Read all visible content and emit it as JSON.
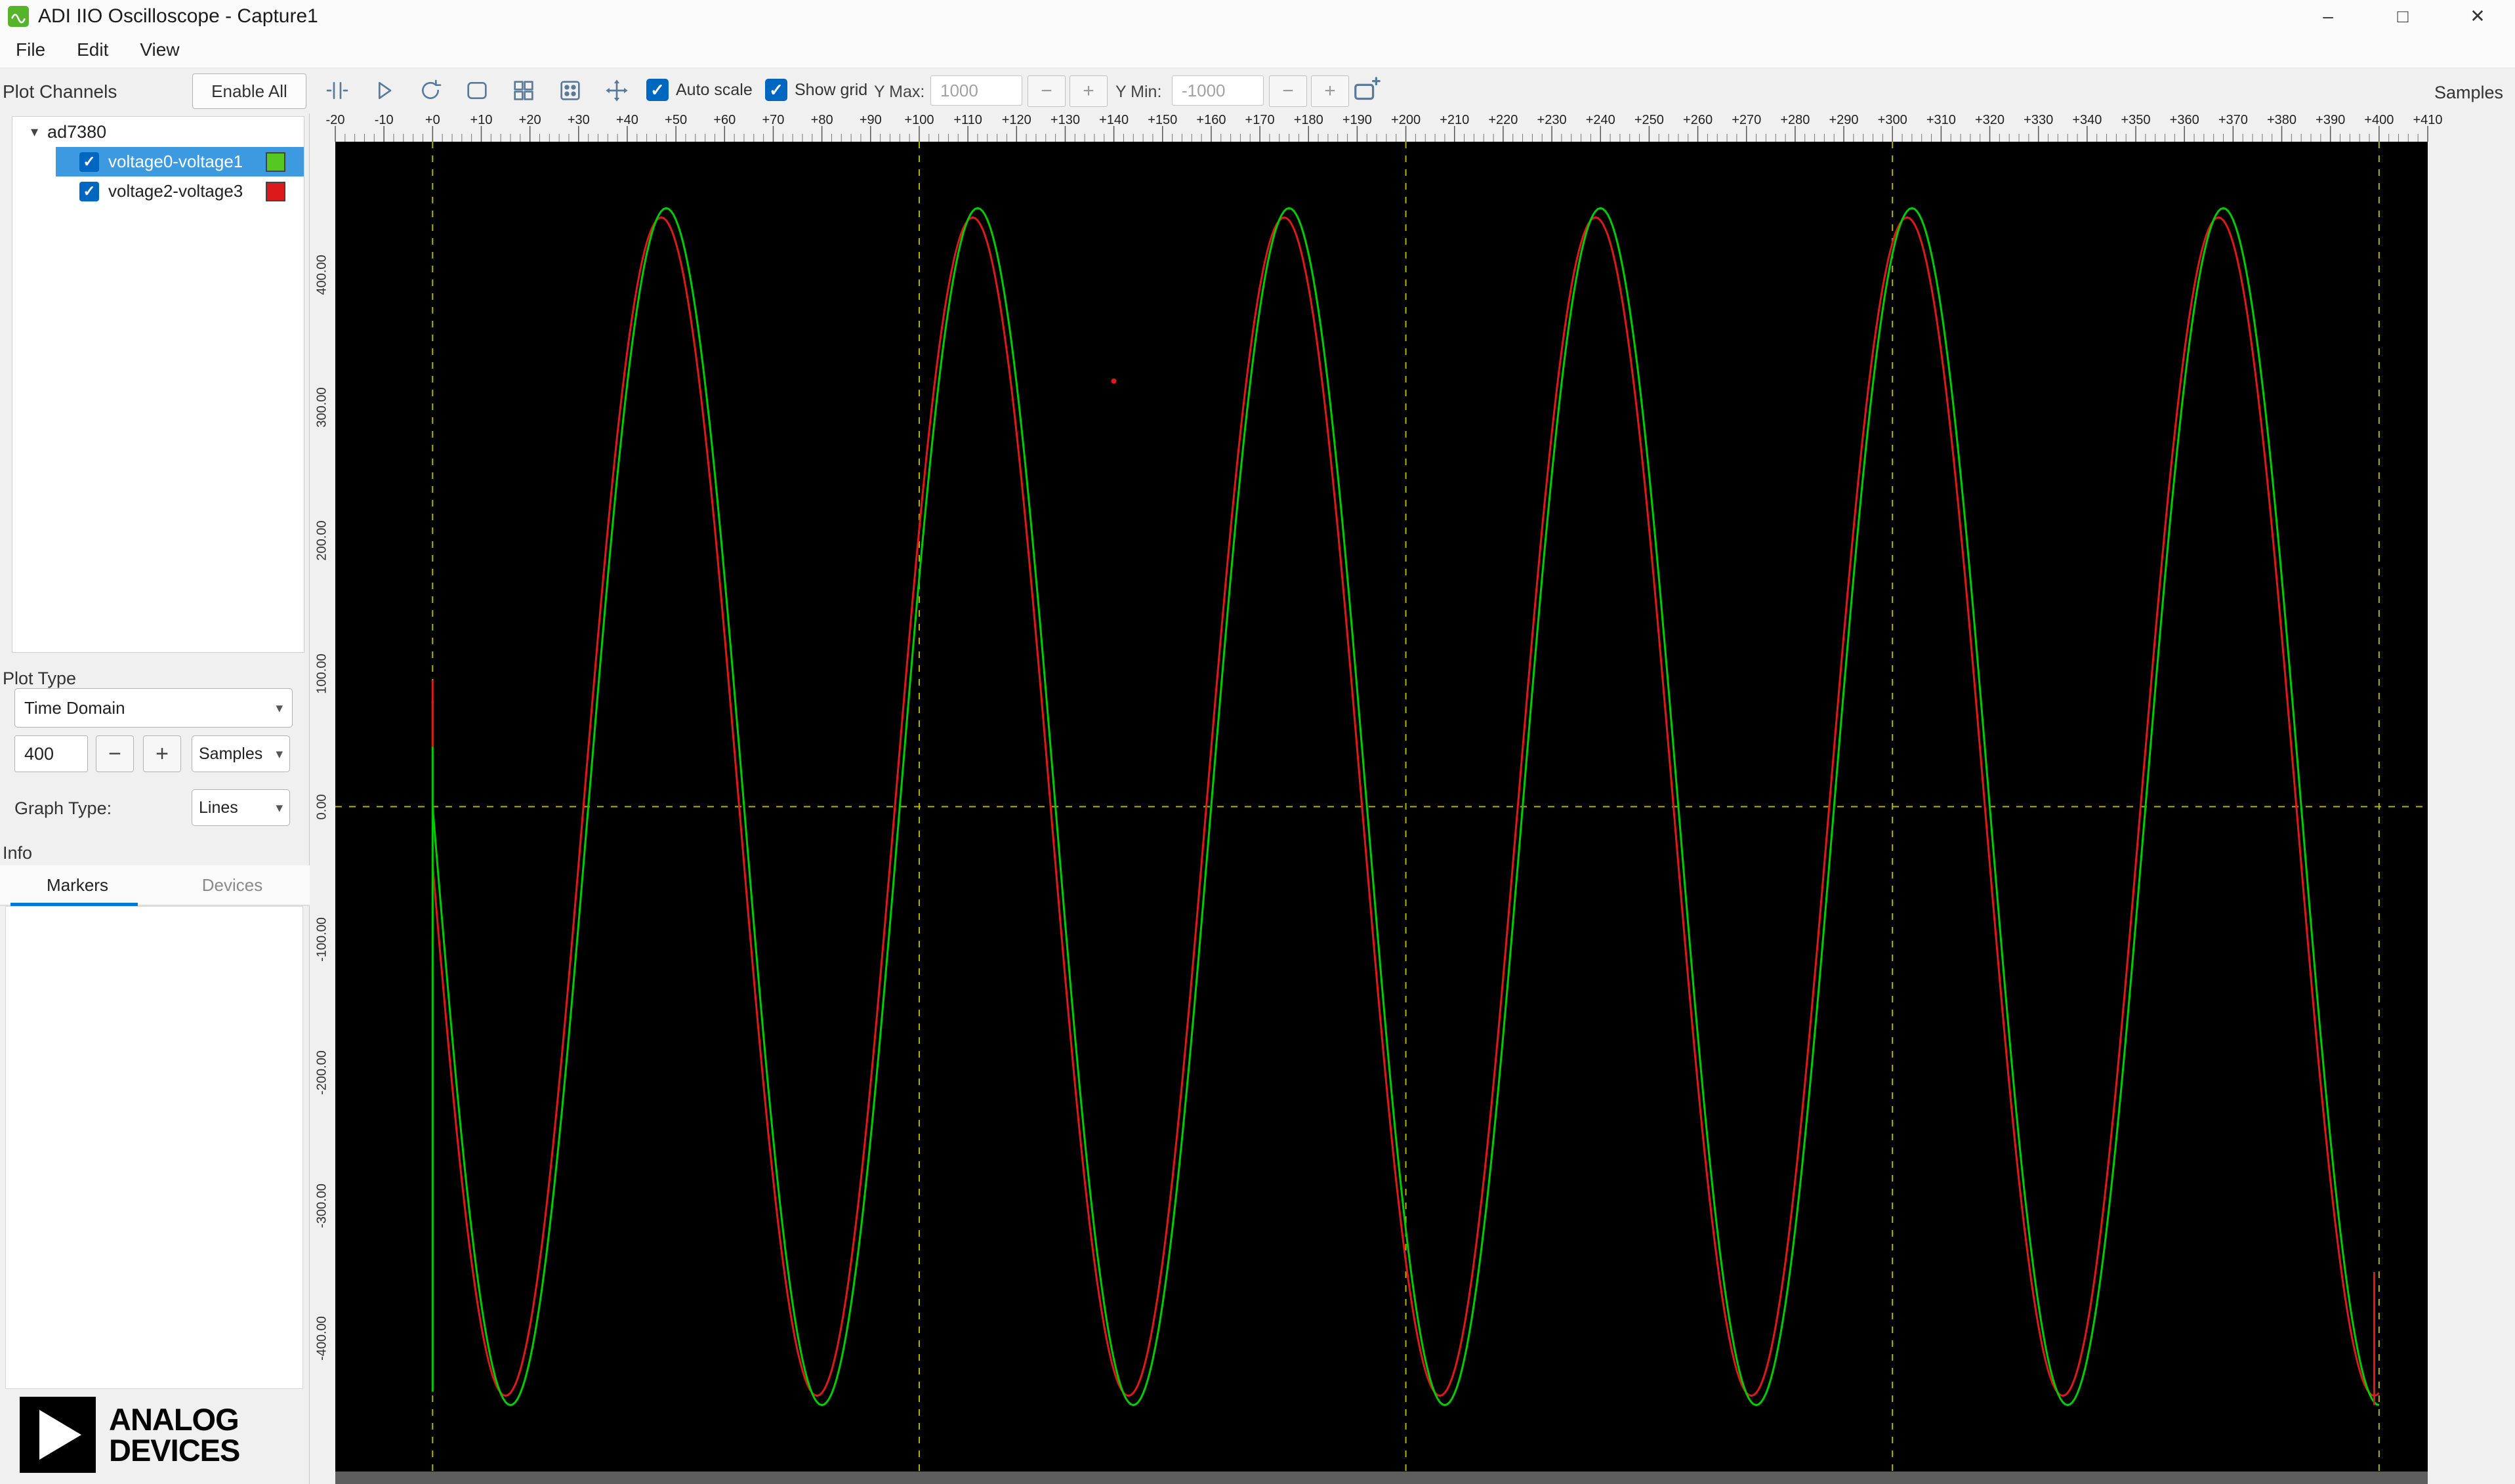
{
  "window": {
    "title": "ADI IIO Oscilloscope - Capture1",
    "controls": {
      "minimize": "–",
      "maximize": "□",
      "close": "✕"
    }
  },
  "menu": {
    "file": "File",
    "edit": "Edit",
    "view": "View"
  },
  "toolbar": {
    "plot_channels_label": "Plot Channels",
    "enable_all_button": "Enable All",
    "auto_scale": {
      "label": "Auto scale",
      "checked": true
    },
    "show_grid": {
      "label": "Show grid",
      "checked": true
    },
    "y_max": {
      "label": "Y Max:",
      "value": "1000"
    },
    "y_min": {
      "label": "Y Min:",
      "value": "-1000"
    },
    "minus_glyph": "−",
    "plus_glyph": "+",
    "samples_axis_label": "Samples"
  },
  "sidebar": {
    "device": "ad7380",
    "channels": [
      {
        "label": "voltage0-voltage1",
        "checked": true,
        "swatch_color": "#56c821",
        "selected": true
      },
      {
        "label": "voltage2-voltage3",
        "checked": true,
        "swatch_color": "#dd1a1a",
        "selected": false
      }
    ],
    "plot_type_label": "Plot Type",
    "plot_type_value": "Time Domain",
    "sample_count": "400",
    "sample_unit": "Samples",
    "graph_type_label": "Graph Type:",
    "graph_type_value": "Lines",
    "info_label": "Info",
    "tabs": {
      "markers": "Markers",
      "devices": "Devices",
      "active": "Markers"
    },
    "logo": {
      "line1": "ANALOG",
      "line2": "DEVICES"
    }
  },
  "colors": {
    "selection_blue": "#3d9ae0",
    "accent_blue": "#0078d7",
    "checkbox_blue": "#0067c0",
    "grid_yellow": "#b4b400",
    "series_green": "#00cc00",
    "series_red": "#dc1a1a"
  },
  "chart_data": {
    "type": "line",
    "title": "",
    "xlabel": "Samples",
    "ylabel": "",
    "x_axis": {
      "min": -20,
      "max": 410,
      "tick_step": 10,
      "minor_step": 2
    },
    "y_axis": {
      "min": -500,
      "max": 500,
      "tick_step": 100
    },
    "x_tick_labels": [
      "-20",
      "-10",
      "+0",
      "+10",
      "+20",
      "+30",
      "+40",
      "+50",
      "+60",
      "+70",
      "+80",
      "+90",
      "+100",
      "+110",
      "+120",
      "+130",
      "+140",
      "+150",
      "+160",
      "+170",
      "+180",
      "+190",
      "+200",
      "+210",
      "+220",
      "+230",
      "+240",
      "+250",
      "+260",
      "+270",
      "+280",
      "+290",
      "+300",
      "+310",
      "+320",
      "+330",
      "+340",
      "+350",
      "+360",
      "+370",
      "+380",
      "+390",
      "+400",
      "+410"
    ],
    "y_ticks": [
      {
        "value": 400,
        "label": "400.00"
      },
      {
        "value": 300,
        "label": "300.00"
      },
      {
        "value": 200,
        "label": "200.00"
      },
      {
        "value": 100,
        "label": "100.00"
      },
      {
        "value": 0,
        "label": "0.00"
      },
      {
        "value": -100,
        "label": "-100.00"
      },
      {
        "value": -200,
        "label": "-200.00"
      },
      {
        "value": -300,
        "label": "-300.00"
      },
      {
        "value": -400,
        "label": "-400.00"
      }
    ],
    "grid": {
      "x_lines": [
        0,
        100,
        200,
        300,
        400
      ],
      "y_lines": [
        0
      ],
      "color": "#b4b400",
      "style": "dashed"
    },
    "series": [
      {
        "name": "voltage0-voltage1",
        "color": "#00cc00",
        "shape": "sine",
        "amplitude": 450,
        "period": 64,
        "zero_cross_rising_at": 32,
        "n_start": 0,
        "n_end": 400
      },
      {
        "name": "voltage2-voltage3",
        "color": "#dc1a1a",
        "shape": "sine",
        "amplitude": 443,
        "period": 64,
        "zero_cross_rising_at": 31,
        "n_start": 0,
        "n_end": 400
      }
    ],
    "artifacts": {
      "lines": [
        {
          "name": "green-start-transient",
          "x": 0,
          "y_from": 80,
          "y_to": -440,
          "color": "#00cc00"
        },
        {
          "name": "red-start-transient",
          "x": 0,
          "y_from": 95,
          "y_to": 45,
          "color": "#dc1a1a"
        },
        {
          "name": "red-end-transient",
          "x": 399,
          "y_from": -350,
          "y_to": -450,
          "color": "#dc1a1a"
        }
      ],
      "dot": {
        "name": "stray-red-dot",
        "x": 140,
        "y": 320,
        "color": "#dc1a1a"
      }
    },
    "legend_position": "none"
  }
}
